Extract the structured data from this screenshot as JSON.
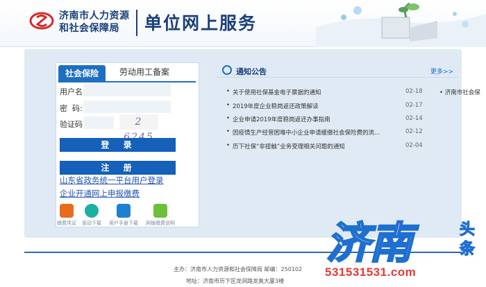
{
  "header": {
    "org_line1": "济南市人力资源",
    "org_line2": "和社会保障局",
    "site_title": "单位网上服务"
  },
  "login": {
    "tabs": [
      {
        "label": "社会保险",
        "active": true
      },
      {
        "label": "劳动用工备案",
        "active": false
      }
    ],
    "username_label": "用户名:",
    "password_label": "密  码:",
    "captcha_label": "验证码:",
    "captcha_text": "2 6245",
    "login_button": "登  录",
    "register_button": "注  册",
    "links": [
      "山东省政务统一平台用户登录",
      "企业开通网上申报缴费"
    ],
    "quick_links": [
      {
        "icon": "receipt-icon",
        "label": "缴费凭证",
        "color": "#e86c1c"
      },
      {
        "icon": "download-icon",
        "label": "驱动下载",
        "color": "#1bb0a0"
      },
      {
        "icon": "manual-icon",
        "label": "用户手册下载",
        "color": "#1f7fd0"
      },
      {
        "icon": "bank-card-icon",
        "label": "网银缴费说明",
        "color": "#6bbf3a"
      }
    ]
  },
  "notice": {
    "title": "通知公告",
    "more": "更多>>",
    "items": [
      {
        "title": "关于使用社保基金电子票据的通知",
        "date": "02-18"
      },
      {
        "title": "2019年度企业稳岗返还政策解读",
        "date": "02-17"
      },
      {
        "title": "企业申请2019年度稳岗返还办事指南",
        "date": "02-14"
      },
      {
        "title": "因疫情生产经营困难中小企业申请缓缴社会保险费的流...",
        "date": "02-12"
      },
      {
        "title": "历下社保“非接触”业务受理相关问题的通知",
        "date": "02-04"
      }
    ],
    "side_item": "济南市社会保"
  },
  "footer": {
    "line1": "主办：济南市人力资源和社会保障局  邮编：250102",
    "line2": "地址：济南市历下区龙洞路龙奥大厦3楼"
  },
  "watermark": {
    "text": "济南头条",
    "number": "531531531.com"
  },
  "colors": {
    "brand": "#1a3f7a",
    "button": "#1560b8",
    "band": "#dfeaf4",
    "watermark_text": "#1f6fd0",
    "watermark_number": "#e53935"
  }
}
